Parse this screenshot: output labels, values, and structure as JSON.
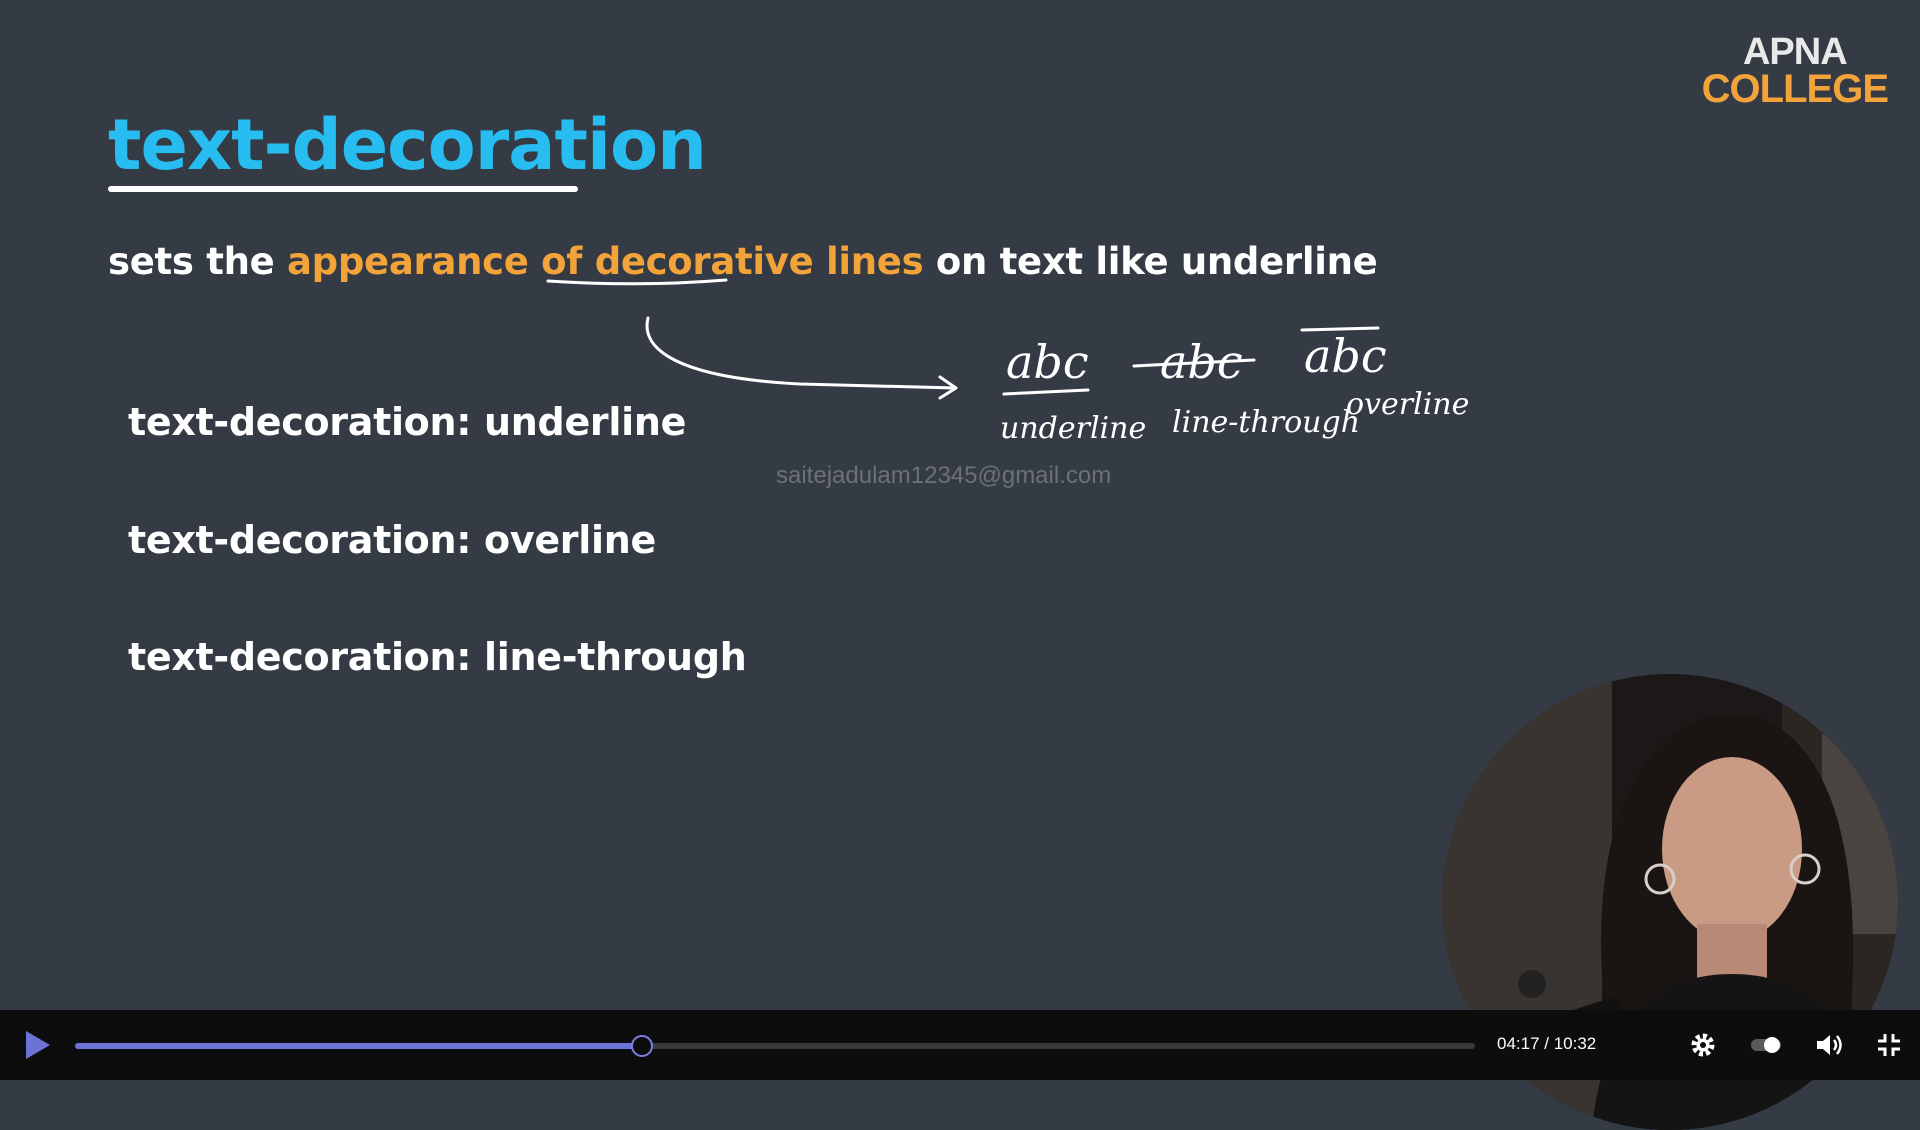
{
  "slide": {
    "title": "text-decoration",
    "description": {
      "part1": "sets the ",
      "highlight1": "appearance of ",
      "highlight2": "decorative",
      "highlight3": " lines",
      "part2": " on text like underline"
    },
    "examples": [
      "text-decoration: underline",
      "text-decoration: overline",
      "text-decoration: line-through"
    ],
    "watermark": "saitejadulam12345@gmail.com",
    "handwritten": {
      "sample": "abc",
      "labels": [
        "underline",
        "line-through",
        "overline"
      ]
    }
  },
  "logo": {
    "line1": "APNA",
    "line2": "COLLEGE"
  },
  "player": {
    "current_time": "04:17",
    "duration": "10:32",
    "time_display": "04:17 / 10:32",
    "progress_fraction": 0.405
  },
  "colors": {
    "background": "#353b45",
    "title": "#28bdf0",
    "highlight": "#f2a33a",
    "progress": "#6d72d6"
  },
  "icons": {
    "play": "play-icon",
    "settings": "gear-icon",
    "toggle": "autoplay-toggle-icon",
    "volume": "volume-icon",
    "fullscreen": "exit-fullscreen-icon"
  }
}
